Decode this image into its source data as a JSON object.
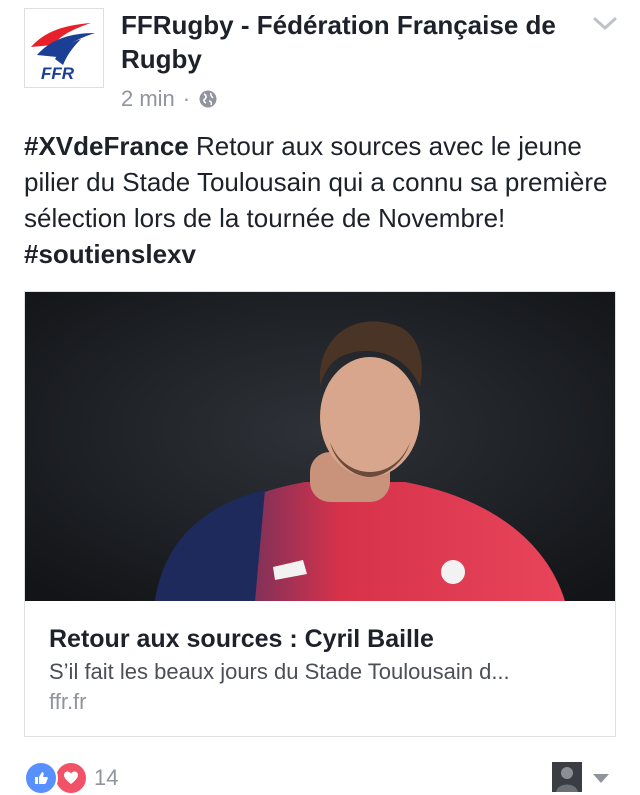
{
  "post": {
    "page_name": "FFRugby - Fédération Française de Rugby",
    "avatar_logo_text": "FFR",
    "timestamp": "2 min",
    "separator": "·",
    "audience_icon": "globe-icon",
    "text": {
      "hashtag_1": "#XVdeFrance",
      "body": " Retour aux sources avec le jeune pilier du Stade Toulousain qui a connu sa première sélection lors de la tournée de Novembre!  ",
      "hashtag_2": "#soutienslexv"
    }
  },
  "link_card": {
    "title": "Retour aux sources : Cyril Baille",
    "description": "S’il fait les beaux jours du Stade Toulousain d...",
    "domain": "ffr.fr"
  },
  "reactions": {
    "icons": [
      "like-icon",
      "love-icon"
    ],
    "count": "14"
  },
  "colors": {
    "text": "#1d2129",
    "meta": "#90949c",
    "like": "#5890ff",
    "love": "#f25268",
    "ffr_blue": "#1b3f95",
    "ffr_red": "#e8202a"
  }
}
